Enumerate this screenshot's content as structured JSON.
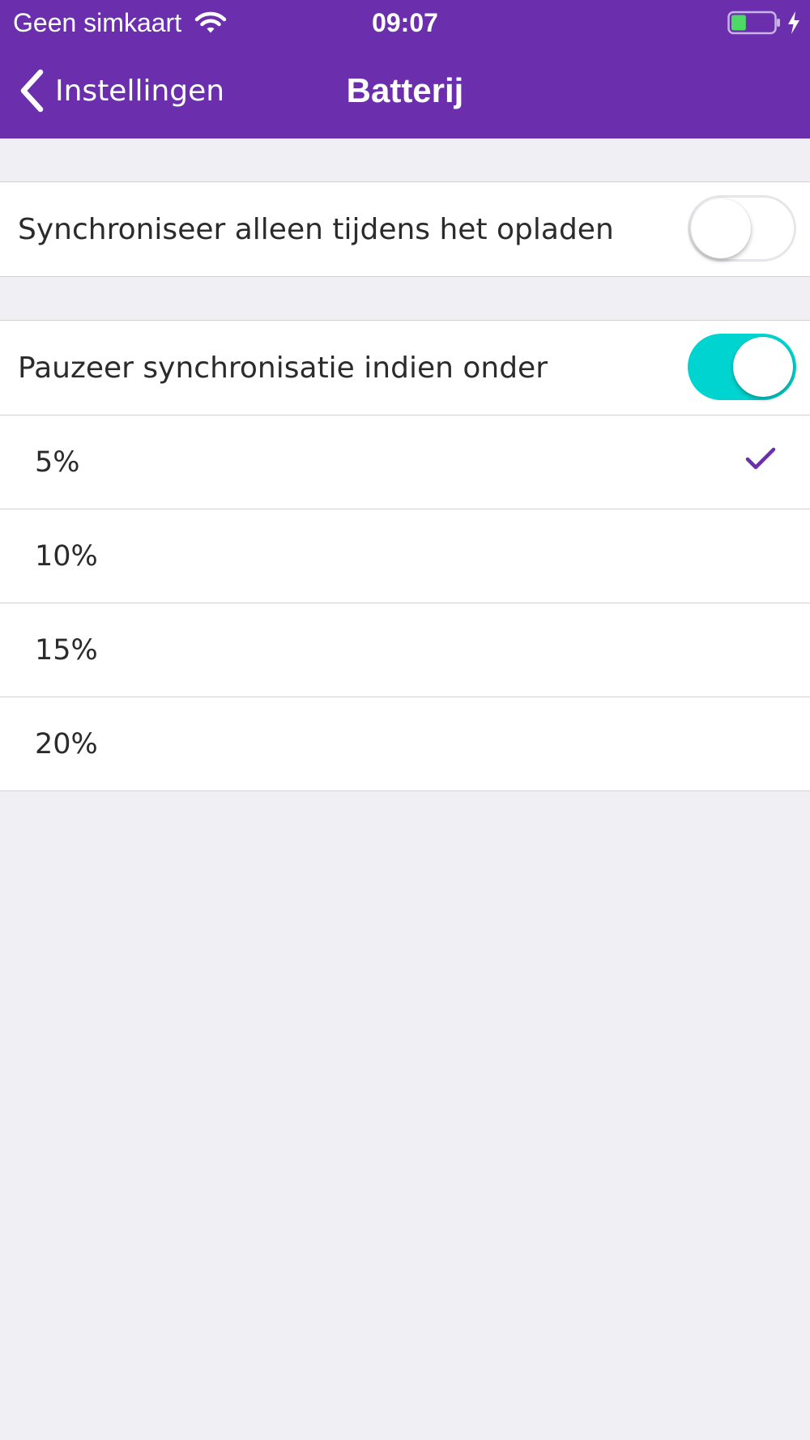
{
  "status_bar": {
    "carrier": "Geen simkaart",
    "time": "09:07",
    "battery_level": 0.35,
    "charging": true,
    "wifi_icon": "wifi-icon",
    "battery_icon": "battery-icon",
    "bolt_icon": "charging-bolt-icon"
  },
  "nav": {
    "back_label": "Instellingen",
    "back_icon": "chevron-left-icon",
    "title": "Batterij"
  },
  "settings": {
    "sync_while_charging": {
      "label": "Synchroniseer alleen tijdens het opladen",
      "enabled": false
    },
    "pause_sync": {
      "label": "Pauzeer synchronisatie indien onder",
      "enabled": true
    },
    "thresholds": [
      {
        "label": "5%",
        "selected": true
      },
      {
        "label": "10%",
        "selected": false
      },
      {
        "label": "15%",
        "selected": false
      },
      {
        "label": "20%",
        "selected": false
      }
    ]
  },
  "colors": {
    "header": "#6b2fad",
    "toggle_on": "#00d4d0",
    "checkmark": "#6b2fad",
    "background": "#efeff4",
    "battery_fill": "#4cd964"
  }
}
